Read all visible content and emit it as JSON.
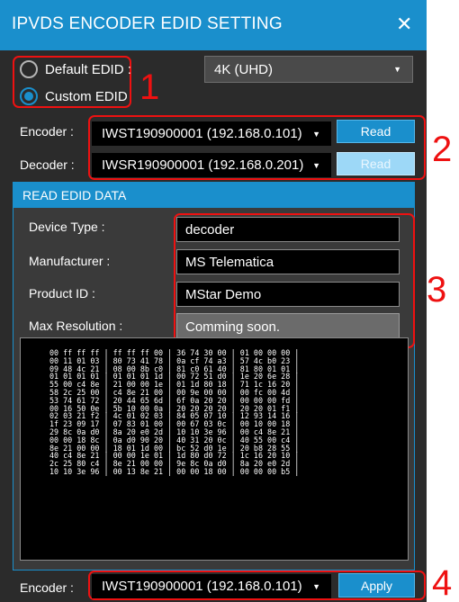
{
  "window": {
    "title": "IPVDS ENCODER EDID SETTING",
    "close_glyph": "✕"
  },
  "edid_mode": {
    "default_label": "Default EDID :",
    "custom_label": "Custom EDID",
    "selected": "custom",
    "default_edid_value": "4K (UHD)"
  },
  "encoder_row": {
    "label": "Encoder :",
    "value": "IWST190900001 (192.168.0.101)",
    "button": "Read"
  },
  "decoder_row": {
    "label": "Decoder :",
    "value": "IWSR190900001 (192.168.0.201)",
    "button": "Read"
  },
  "read_edid": {
    "header": "READ EDID DATA",
    "fields": [
      {
        "label": "Device Type :",
        "value": "decoder"
      },
      {
        "label": "Manufacturer :",
        "value": "MS Telematica"
      },
      {
        "label": "Product ID :",
        "value": "MStar Demo"
      },
      {
        "label": "Max Resolution :",
        "value": "Comming soon."
      }
    ],
    "hex_lines": [
      "00 ff ff ff | ff ff ff 00 | 36 74 30 00 | 01 00 00 00 |",
      "00 11 01 03 | 80 73 41 78 | 0a cf 74 a3 | 57 4c b0 23 |",
      "09 48 4c 21 | 08 00 8b c0 | 81 c0 61 40 | 81 80 01 01 |",
      "01 01 01 01 | 01 01 01 1d | 00 72 51 d0 | 1e 20 6e 28 |",
      "55 00 c4 8e | 21 00 00 1e | 01 1d 80 18 | 71 1c 16 20 |",
      "58 2c 25 00 | c4 8e 21 00 | 00 9e 00 00 | 00 fc 00 4d |",
      "53 74 61 72 | 20 44 65 6d | 6f 0a 20 20 | 00 00 00 fd |",
      "00 16 50 0e | 5b 10 00 0a | 20 20 20 20 | 20 20 01 f1 |",
      "02 03 21 f2 | 4c 01 02 03 | 84 05 07 10 | 12 93 14 16 |",
      "1f 23 09 17 | 07 83 01 00 | 00 67 03 0c | 00 10 00 18 |",
      "29 8c 0a d0 | 8a 20 e0 2d | 10 10 3e 96 | 00 c4 8e 21 |",
      "00 00 18 8c | 0a d0 90 20 | 40 31 20 0c | 40 55 00 c4 |",
      "8e 21 00 00 | 18 01 1d 00 | bc 52 d0 1e | 20 b8 28 55 |",
      "40 c4 8e 21 | 00 00 1e 01 | 1d 80 d0 72 | 1c 16 20 10 |",
      "2c 25 80 c4 | 8e 21 00 00 | 9e 8c 0a d0 | 8a 20 e0 2d |",
      "10 10 3e 96 | 00 13 8e 21 | 00 00 18 00 | 00 00 00 b5 |"
    ]
  },
  "apply_row": {
    "label": "Encoder :",
    "value": "IWST190900001 (192.168.0.101)",
    "button": "Apply"
  },
  "callouts": [
    "1",
    "2",
    "3",
    "4"
  ]
}
